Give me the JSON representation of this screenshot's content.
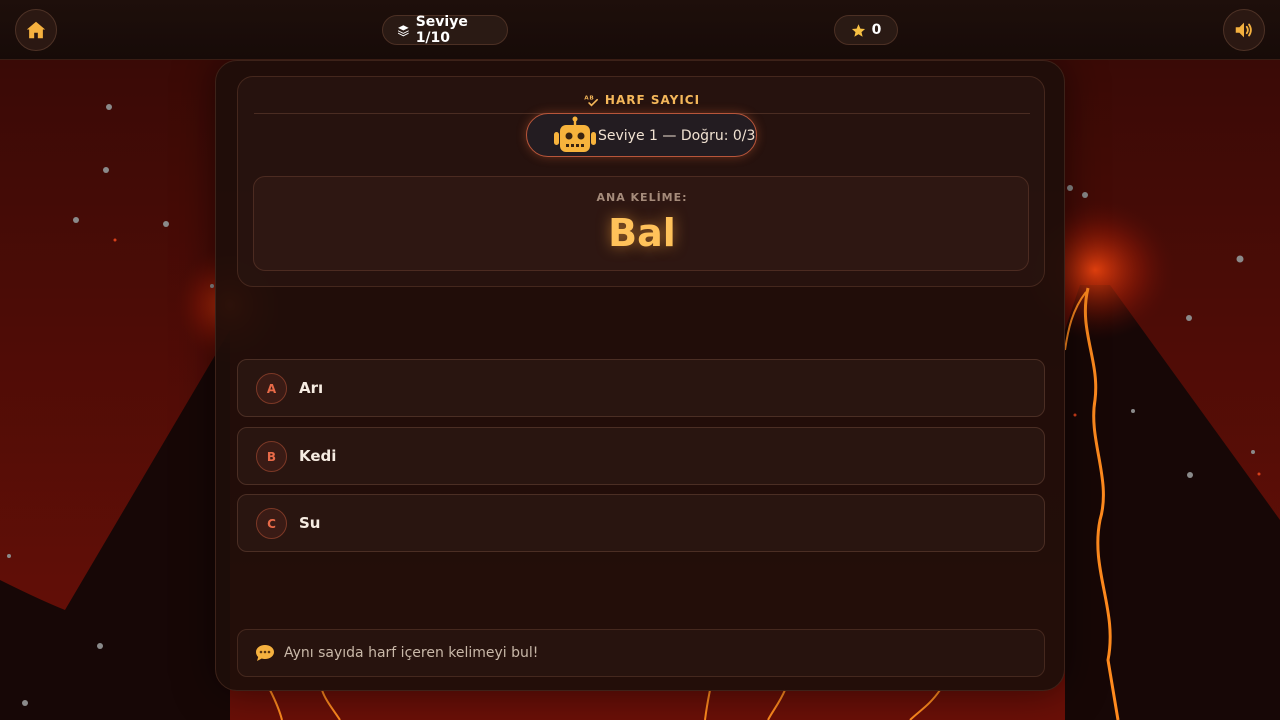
{
  "topbar": {
    "home_icon": "home-icon",
    "level": "Seviye 1/10",
    "level_icon": "layers-icon",
    "score": "0",
    "score_icon": "star-icon",
    "sound_icon": "speaker-icon"
  },
  "game": {
    "title": "HARF SAYICI",
    "title_icon": "letters-check-icon",
    "level_status": "Seviye 1 — Doğru: 0/3",
    "mascot_icon": "robot-icon",
    "word_label": "ANA KELİME:",
    "word": "Bal"
  },
  "options": [
    {
      "letter": "A",
      "text": "Arı"
    },
    {
      "letter": "B",
      "text": "Kedi"
    },
    {
      "letter": "C",
      "text": "Su"
    }
  ],
  "hint": {
    "icon": "speech-bubble-icon",
    "text": "Aynı sayıda harf içeren kelimeyi bul!"
  },
  "colors": {
    "accent": "#ffc25a",
    "option_letter": "#e86a48",
    "lava": "#ff8a1e",
    "background": "#150a08"
  }
}
